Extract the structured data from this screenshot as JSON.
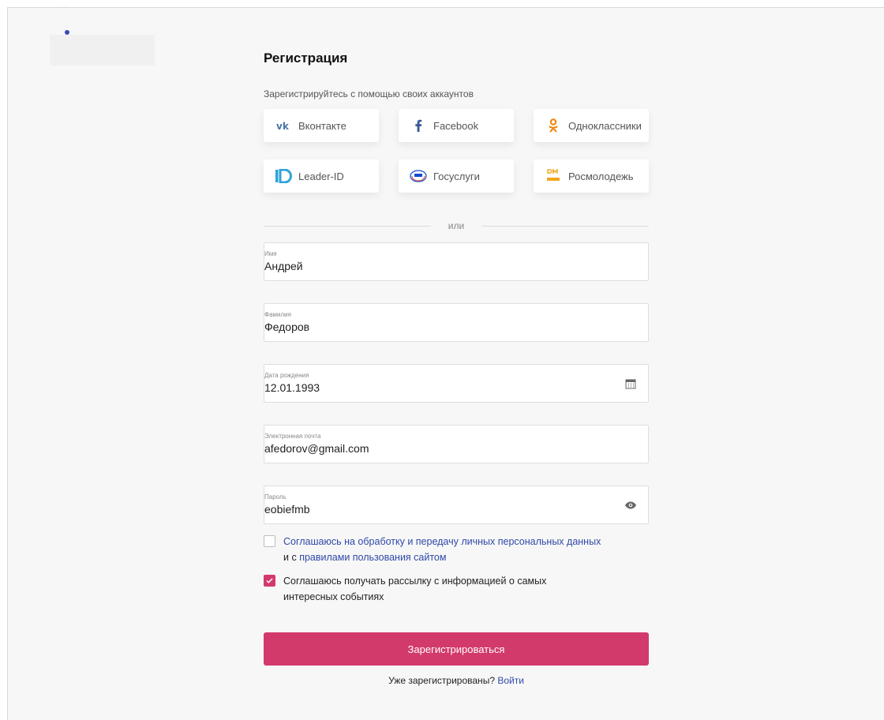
{
  "page": {
    "title": "Регистрация",
    "subtitle": "Зарегистрируйтесь с помощью своих аккаунтов",
    "divider_text": "или"
  },
  "social": [
    {
      "label": "Вконтакте",
      "icon": "vk-icon",
      "color": "#4a76a8"
    },
    {
      "label": "Facebook",
      "icon": "facebook-icon",
      "color": "#3b5998"
    },
    {
      "label": "Одноклассники",
      "icon": "odnoklassniki-icon",
      "color": "#ee8208"
    },
    {
      "label": "Leader-ID",
      "icon": "leader-id-icon",
      "color": "#2ea3d6"
    },
    {
      "label": "Госуслуги",
      "icon": "gosuslugi-icon",
      "color": "#0d4cd3"
    },
    {
      "label": "Росмолодежь",
      "icon": "rosmolodezh-icon",
      "color": "#f2a61d"
    }
  ],
  "fields": {
    "first_name": {
      "label": "Имя",
      "value": "Андрей"
    },
    "last_name": {
      "label": "Фамилия",
      "value": "Федоров"
    },
    "birth_date": {
      "label": "Дата рождения",
      "value": "12.01.1993",
      "icon": "calendar-icon"
    },
    "email": {
      "label": "Электронная почта",
      "value": "afedorov@gmail.com"
    },
    "password": {
      "label": "Пароль",
      "value": "eobiefmb",
      "icon": "eye-icon"
    }
  },
  "consents": {
    "personal_data": {
      "checked": false,
      "link1": "Соглашаюсь на обработку и передачу личных персональных данных",
      "middle": "и с",
      "link2": "правилами пользования сайтом"
    },
    "newsletter": {
      "checked": true,
      "line1": "Соглашаюсь получать рассылку с информацией о самых",
      "line2": "интересных событиях"
    }
  },
  "submit_label": "Зарегистрироваться",
  "login_prompt": {
    "text": "Уже зарегистрированы?",
    "link": "Войти"
  },
  "colors": {
    "accent": "#d33a6c",
    "link": "#2f49a8",
    "panel_bg": "#f7f7f7"
  }
}
